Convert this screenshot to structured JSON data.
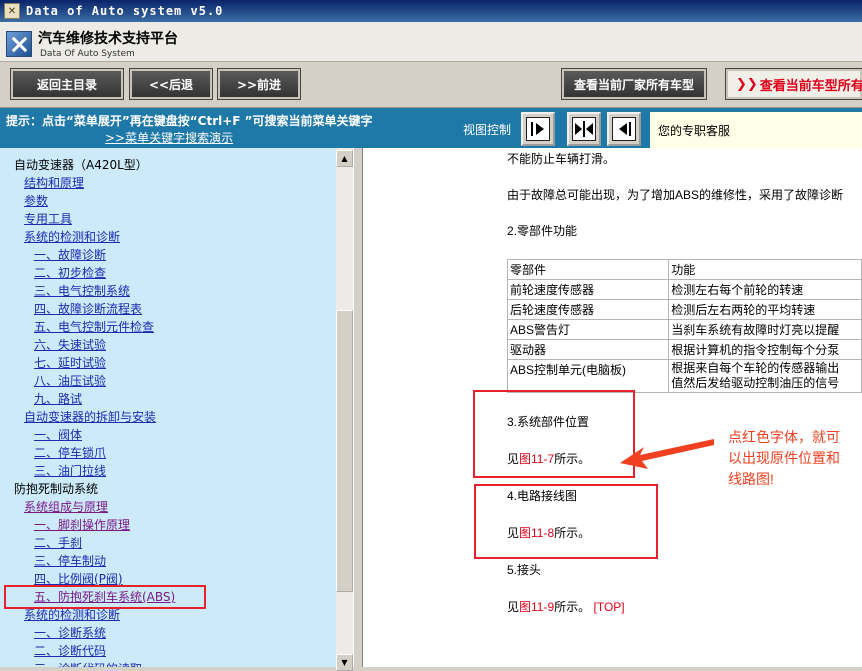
{
  "window": {
    "title": "Data of Auto system v5.0"
  },
  "banner": {
    "title": "汽车维修技术支持平台",
    "subtitle": "Data Of Auto System"
  },
  "toolbar": {
    "home": "返回主目录",
    "back": "<<后退",
    "forward": ">>前进",
    "all_models": "查看当前厂家所有车型",
    "current_model": "查看当前车型所有"
  },
  "hintbar": {
    "hint": "提示：点击“菜单展开”再在键盘按“Ctrl+F ”可搜索当前菜单关键字",
    "demo_link": ">>菜单关键字搜索演示",
    "view_control": "视图控制",
    "expert": "您的专职客服"
  },
  "tree": [
    {
      "level": 0,
      "label": "自动变速器（A420L型）"
    },
    {
      "level": 1,
      "label": "结构和原理"
    },
    {
      "level": 1,
      "label": "参数"
    },
    {
      "level": 1,
      "label": "专用工具"
    },
    {
      "level": 1,
      "label": "系统的检测和诊断"
    },
    {
      "level": 2,
      "label": "一、故障诊断"
    },
    {
      "level": 2,
      "label": "二、初步检查"
    },
    {
      "level": 2,
      "label": "三、电气控制系统"
    },
    {
      "level": 2,
      "label": "四、故障诊断流程表"
    },
    {
      "level": 2,
      "label": "五、电气控制元件检查"
    },
    {
      "level": 2,
      "label": "六、失速试验"
    },
    {
      "level": 2,
      "label": "七、延时试验"
    },
    {
      "level": 2,
      "label": "八、油压试验"
    },
    {
      "level": 2,
      "label": "九、路试"
    },
    {
      "level": 1,
      "label": "自动变速器的拆卸与安装"
    },
    {
      "level": 2,
      "label": "一、阀体"
    },
    {
      "level": 2,
      "label": "二、停车锁爪"
    },
    {
      "level": 2,
      "label": "三、油门拉线"
    },
    {
      "level": 0,
      "label": "防抱死制动系统"
    },
    {
      "level": 1,
      "label": "系统组成与原理",
      "visited": true
    },
    {
      "level": 2,
      "label": "一、脚刹操作原理",
      "visited": true
    },
    {
      "level": 2,
      "label": "二、手刹"
    },
    {
      "level": 2,
      "label": "三、停车制动"
    },
    {
      "level": 2,
      "label": "四、比例阀(P阀)"
    },
    {
      "level": 2,
      "label": "五、防抱死刹车系统(ABS)",
      "visited": true,
      "highlighted": true
    },
    {
      "level": 1,
      "label": "系统的检测和诊断"
    },
    {
      "level": 2,
      "label": "一、诊断系统"
    },
    {
      "level": 2,
      "label": "二、诊断代码"
    },
    {
      "level": 2,
      "label": "三、诊断代码的读取"
    }
  ],
  "content": {
    "line1": "不能防止车辆打滑。",
    "line2": "由于故障总可能出现，为了增加ABS的维修性，采用了故障诊断",
    "section2": "2.零部件功能",
    "table": {
      "headers": [
        "零部件",
        "功能"
      ],
      "rows": [
        [
          "前轮速度传感器",
          "检测左右每个前轮的转速"
        ],
        [
          "后轮速度传感器",
          "检测后左右两轮的平均转速"
        ],
        [
          "ABS警告灯",
          "当刹车系统有故障时灯亮以提醒"
        ],
        [
          "驱动器",
          "根据计算机的指令控制每个分泵"
        ],
        [
          "ABS控制单元(电脑板)",
          "根据来自每个车轮的传感器输出\n值然后发给驱动控制油压的信号"
        ]
      ]
    },
    "section3": "3.系统部件位置",
    "see3_pre": "见",
    "see3_link": "图11-7",
    "see3_post": "所示。",
    "section4": "4.电路接线图",
    "see4_pre": "见",
    "see4_link": "图11-8",
    "see4_post": "所示。",
    "section5": "5.接头",
    "see5_pre": "见",
    "see5_link": "图11-9",
    "see5_post": "所示。",
    "top_link": "[TOP]",
    "annotation": [
      "点红色字体，就可",
      "以出现原件位置和",
      "线路图!"
    ]
  },
  "colors": {
    "accent_red": "#e0001a",
    "tree_bg": "#cdeafa",
    "hint_bg": "#1e78a8",
    "link": "#1a2cb0"
  }
}
